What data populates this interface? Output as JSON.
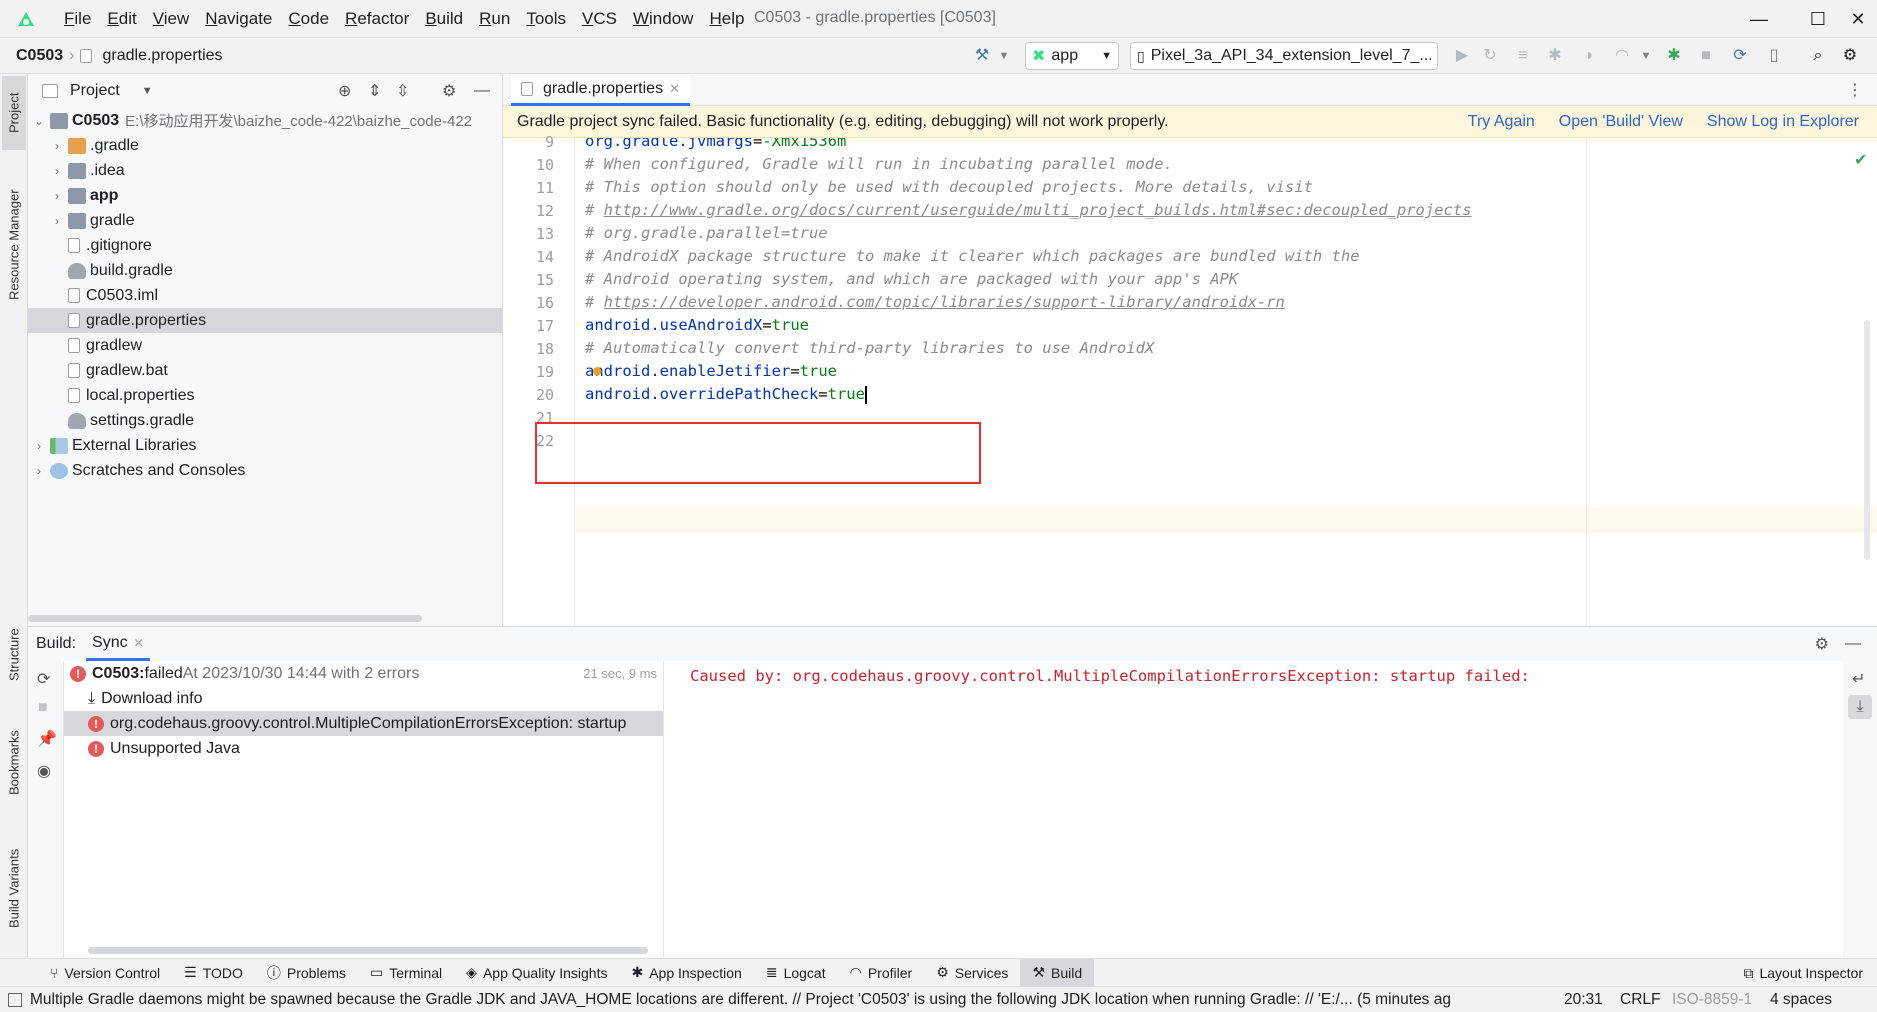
{
  "menu": {
    "items": [
      "File",
      "Edit",
      "View",
      "Navigate",
      "Code",
      "Refactor",
      "Build",
      "Run",
      "Tools",
      "VCS",
      "Window",
      "Help"
    ],
    "window_title": "C0503 - gradle.properties [C0503]"
  },
  "nav": {
    "project": "C0503",
    "file": "gradle.properties",
    "run_config": "app",
    "device": "Pixel_3a_API_34_extension_level_7_..."
  },
  "left_stripe": {
    "project": "Project",
    "resource_manager": "Resource Manager",
    "structure": "Structure",
    "bookmarks": "Bookmarks",
    "build_variants": "Build Variants"
  },
  "project_panel": {
    "title": "Project",
    "root_name": "C0503",
    "root_path": "E:\\移动应用开发\\baizhe_code-422\\baizhe_code-422",
    "items": [
      {
        "label": ".gradle",
        "type": "folder-orange",
        "expandable": true,
        "bold": false
      },
      {
        "label": ".idea",
        "type": "folder",
        "expandable": true,
        "bold": false
      },
      {
        "label": "app",
        "type": "folder",
        "expandable": true,
        "bold": true
      },
      {
        "label": "gradle",
        "type": "folder",
        "expandable": true,
        "bold": false
      },
      {
        "label": ".gitignore",
        "type": "file",
        "expandable": false,
        "bold": false
      },
      {
        "label": "build.gradle",
        "type": "gradle",
        "expandable": false,
        "bold": false
      },
      {
        "label": "C0503.iml",
        "type": "file",
        "expandable": false,
        "bold": false
      },
      {
        "label": "gradle.properties",
        "type": "file",
        "expandable": false,
        "bold": false,
        "selected": true
      },
      {
        "label": "gradlew",
        "type": "file",
        "expandable": false,
        "bold": false
      },
      {
        "label": "gradlew.bat",
        "type": "file",
        "expandable": false,
        "bold": false
      },
      {
        "label": "local.properties",
        "type": "file",
        "expandable": false,
        "bold": false
      },
      {
        "label": "settings.gradle",
        "type": "gradle",
        "expandable": false,
        "bold": false
      }
    ],
    "external_libraries": "External Libraries",
    "scratches": "Scratches and Consoles"
  },
  "editor": {
    "tab_label": "gradle.properties",
    "banner_text": "Gradle project sync failed. Basic functionality (e.g. editing, debugging) will not work properly.",
    "banner_links": [
      "Try Again",
      "Open 'Build' View",
      "Show Log in Explorer"
    ],
    "lines": [
      {
        "n": "9",
        "kind": "partial",
        "key": "org.gradle.jvmargs",
        "val": "-Xmx1536m"
      },
      {
        "n": "10",
        "kind": "comment",
        "text": "# When configured, Gradle will run in incubating parallel mode."
      },
      {
        "n": "11",
        "kind": "comment",
        "text": "# This option should only be used with decoupled projects. More details, visit"
      },
      {
        "n": "12",
        "kind": "link",
        "prefix": "# ",
        "text": "http://www.gradle.org/docs/current/userguide/multi_project_builds.html#sec:decoupled_projects"
      },
      {
        "n": "13",
        "kind": "comment",
        "text": "# org.gradle.parallel=true"
      },
      {
        "n": "14",
        "kind": "comment",
        "text": "# AndroidX package structure to make it clearer which packages are bundled with the"
      },
      {
        "n": "15",
        "kind": "comment",
        "text": "# Android operating system, and which are packaged with your app's APK"
      },
      {
        "n": "16",
        "kind": "link",
        "prefix": "# ",
        "text": "https://developer.android.com/topic/libraries/support-library/androidx-rn"
      },
      {
        "n": "17",
        "kind": "prop",
        "key": "android.useAndroidX",
        "val": "true"
      },
      {
        "n": "18",
        "kind": "comment",
        "text": "# Automatically convert third-party libraries to use AndroidX"
      },
      {
        "n": "19",
        "kind": "prop",
        "key": "android.enableJetifier",
        "val": "true"
      },
      {
        "n": "20",
        "kind": "prop",
        "key": "android.overridePathCheck",
        "val": "true"
      },
      {
        "n": "21",
        "kind": "empty"
      },
      {
        "n": "22",
        "kind": "empty"
      }
    ]
  },
  "build": {
    "label": "Build:",
    "tab": "Sync",
    "tree": [
      {
        "bold": "C0503:",
        "text": " failed",
        "suffix": " At 2023/10/30 14:44 with 2 errors",
        "time": "21 sec, 9 ms",
        "icon": "error"
      },
      {
        "text": "Download info",
        "icon": "download"
      },
      {
        "text": "org.codehaus.groovy.control.MultipleCompilationErrorsException: startup",
        "icon": "error",
        "selected": true
      },
      {
        "text": "Unsupported Java",
        "icon": "error"
      }
    ],
    "output": "Caused by: org.codehaus.groovy.control.MultipleCompilationErrorsException: startup failed:"
  },
  "bottom_tabs": [
    "Version Control",
    "TODO",
    "Problems",
    "Terminal",
    "App Quality Insights",
    "App Inspection",
    "Logcat",
    "Profiler",
    "Services",
    "Build"
  ],
  "layout_inspector": "Layout Inspector",
  "status": {
    "message": "Multiple Gradle daemons might be spawned because the Gradle JDK and JAVA_HOME locations are different. // Project 'C0503' is using the following JDK location when running Gradle: // 'E:/... (5 minutes ag",
    "position": "20:31",
    "line_sep": "CRLF",
    "encoding": "ISO-8859-1",
    "indent": "4 spaces"
  }
}
